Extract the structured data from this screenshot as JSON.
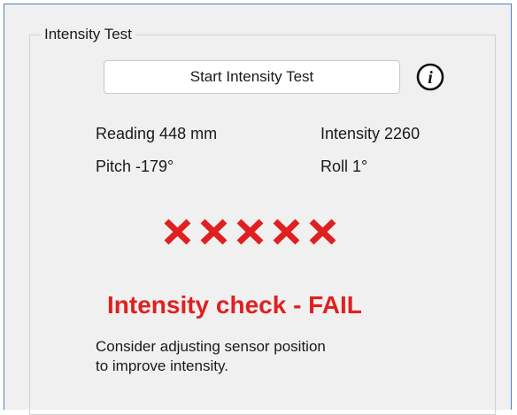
{
  "group": {
    "title": "Intensity Test"
  },
  "start_button": {
    "label": "Start Intensity Test"
  },
  "info_icon": {
    "icon": "info-icon",
    "glyph": "i"
  },
  "readings": {
    "reading": "Reading 448 mm",
    "intensity": "Intensity 2260",
    "pitch": "Pitch -179°",
    "roll": "Roll 1°"
  },
  "status_marks": {
    "icon": "cross-icon",
    "count": 5,
    "color": "#e02020"
  },
  "result": {
    "text": "Intensity check - FAIL",
    "color": "#e02020"
  },
  "advice": {
    "line1": "Consider adjusting sensor position",
    "line2": "to improve intensity."
  }
}
